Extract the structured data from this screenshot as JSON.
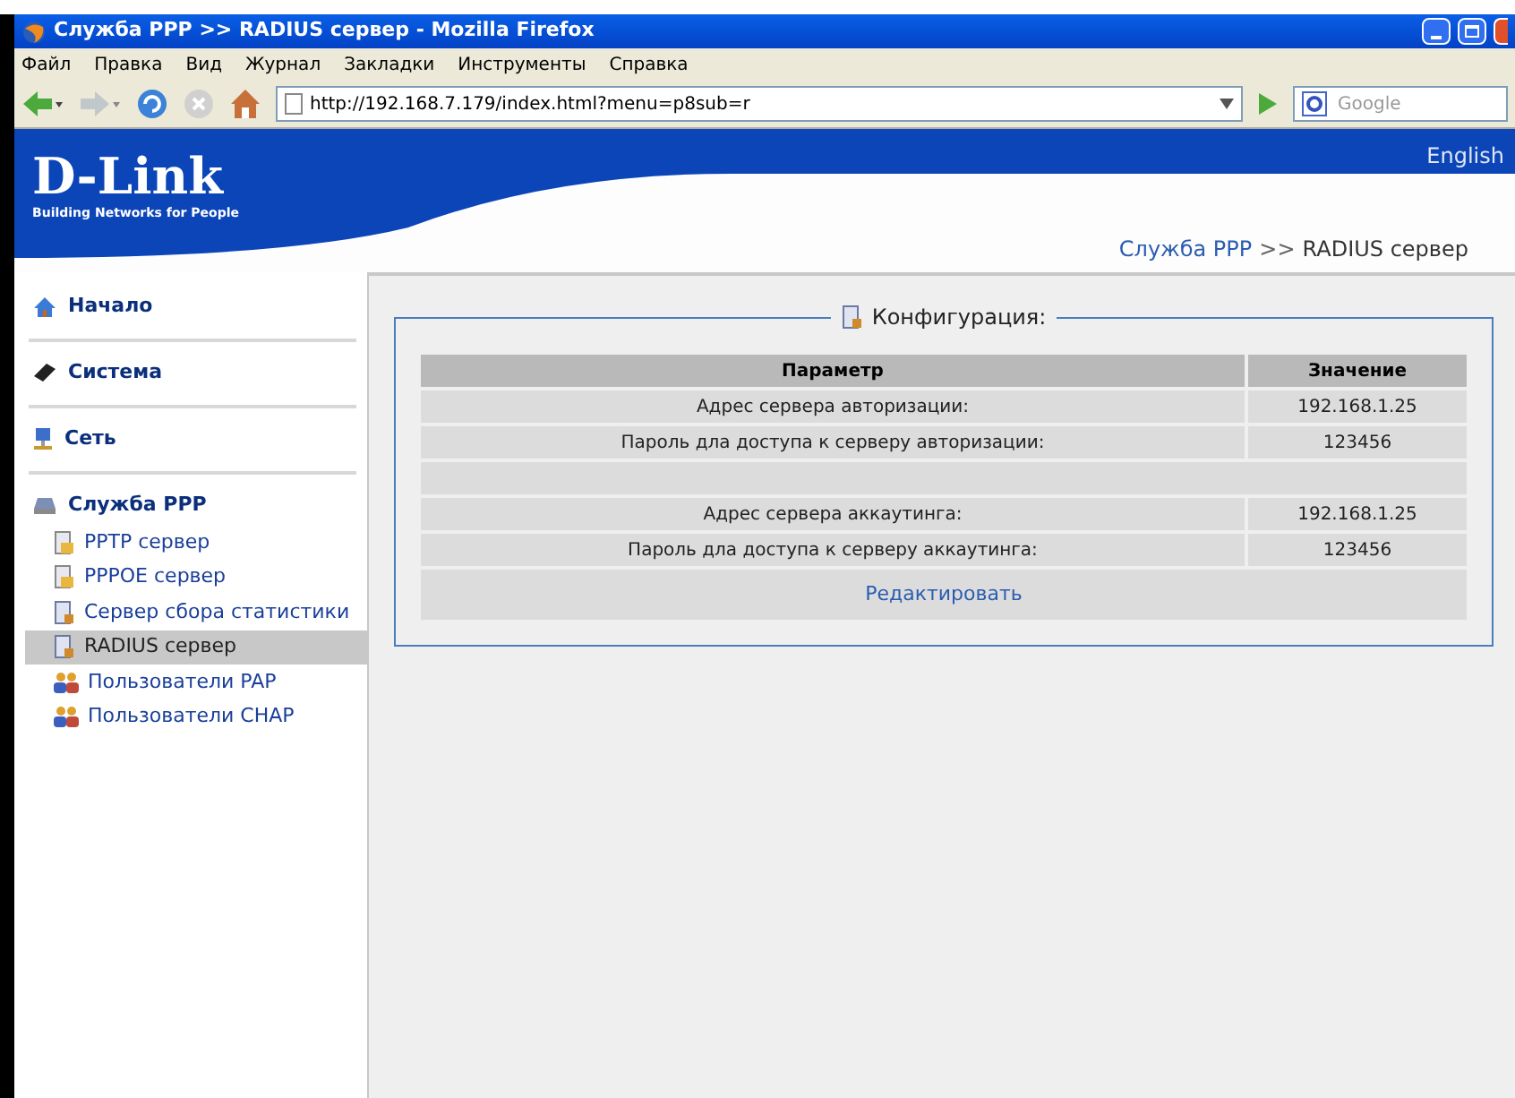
{
  "window": {
    "title": "Служба PPP >> RADIUS сервер - Mozilla Firefox"
  },
  "menu": [
    "Файл",
    "Правка",
    "Вид",
    "Журнал",
    "Закладки",
    "Инструменты",
    "Справка"
  ],
  "address": {
    "value": "http://192.168.7.179/index.html?menu=p8sub=r"
  },
  "search": {
    "placeholder": "Google"
  },
  "header": {
    "logo": "D-Link",
    "tagline": "Building Networks for People",
    "language": "English"
  },
  "breadcrumb": {
    "link": "Служба PPP",
    "separator": ">>",
    "current": "RADIUS сервер"
  },
  "sidebar": [
    {
      "label": "Начало"
    },
    {
      "label": "Система"
    },
    {
      "label": "Сеть"
    },
    {
      "label": "Служба PPP",
      "children": [
        {
          "label": "PPTP сервер",
          "selected": false
        },
        {
          "label": "PPPOE сервер",
          "selected": false
        },
        {
          "label": "Сервер сбора статистики",
          "selected": false
        },
        {
          "label": "RADIUS сервер",
          "selected": true
        },
        {
          "label": "Пользователи PAP",
          "selected": false
        },
        {
          "label": "Пользователи CHAP",
          "selected": false
        }
      ]
    }
  ],
  "panel": {
    "legend": "Конфигурация:",
    "columns": [
      "Параметр",
      "Значение"
    ],
    "rows": [
      {
        "kind": "data",
        "parameter": "Адрес сервера авторизации:",
        "value": "192.168.1.25"
      },
      {
        "kind": "data",
        "parameter": "Пароль дла доступа к серверу авторизации:",
        "value": "123456"
      },
      {
        "kind": "spacer"
      },
      {
        "kind": "data",
        "parameter": "Адрес сервера аккаутинга:",
        "value": "192.168.1.25"
      },
      {
        "kind": "data",
        "parameter": "Пароль дла доступа к серверу аккаутинга:",
        "value": "123456"
      }
    ],
    "edit_link": "Редактировать"
  }
}
